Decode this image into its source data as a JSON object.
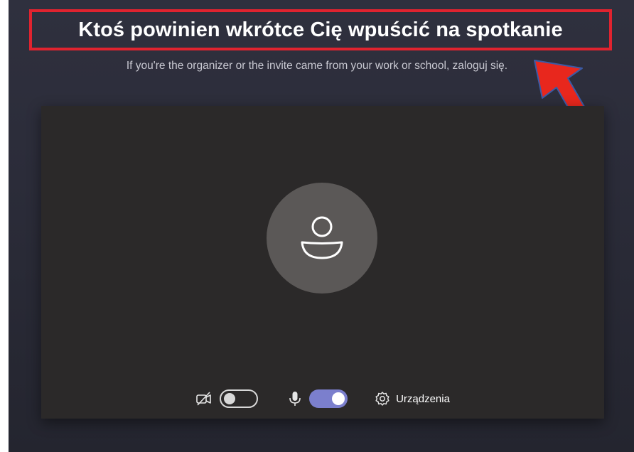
{
  "prejoin": {
    "title": "Ktoś powinien wkrótce Cię wpuścić na spotkanie",
    "subtitle": "If you're the organizer or the invite came from your work or school, zaloguj się."
  },
  "controls": {
    "camera": {
      "icon": "camera-off-icon",
      "enabled": false
    },
    "microphone": {
      "icon": "microphone-icon",
      "enabled": true
    },
    "devices": {
      "icon": "gear-icon",
      "label": "Urządzenia"
    }
  },
  "colors": {
    "highlight_box": "#e0232f",
    "arrow": "#e8271d",
    "toggle_on": "#7b7fcd",
    "preview_bg": "#2b2929",
    "app_bg": "#2b2c39"
  }
}
